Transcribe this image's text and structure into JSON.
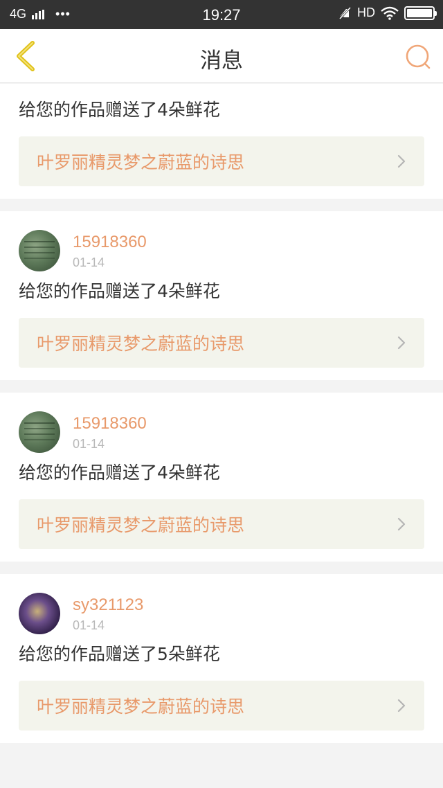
{
  "status_bar": {
    "network": "4G",
    "dots": "•••",
    "time": "19:27",
    "hd": "HD"
  },
  "header": {
    "title": "消息"
  },
  "colors": {
    "accent": "#e8996a",
    "back_arrow": "#e0c21a",
    "search_icon": "#f0a678",
    "link_bg": "#f3f4ec"
  },
  "messages": [
    {
      "text": "给您的作品赠送了4朵鲜花",
      "work": "叶罗丽精灵梦之蔚蓝的诗思"
    },
    {
      "username": "15918360",
      "date": "01-14",
      "text": "给您的作品赠送了4朵鲜花",
      "work": "叶罗丽精灵梦之蔚蓝的诗思"
    },
    {
      "username": "15918360",
      "date": "01-14",
      "text": "给您的作品赠送了4朵鲜花",
      "work": "叶罗丽精灵梦之蔚蓝的诗思"
    },
    {
      "username": "sy321123",
      "date": "01-14",
      "text": "给您的作品赠送了5朵鲜花",
      "work": "叶罗丽精灵梦之蔚蓝的诗思"
    }
  ]
}
